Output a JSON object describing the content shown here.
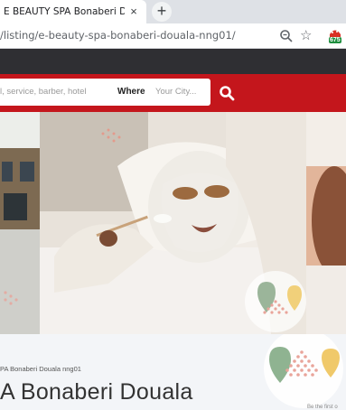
{
  "browser": {
    "tab_title": "E BEAUTY SPA Bonaberi Douala",
    "tab_close": "×",
    "new_tab": "+",
    "url": "/listing/e-beauty-spa-bonaberi-douala-nng01/",
    "icons": [
      "zoom-icon",
      "star-icon",
      "extension-icon"
    ],
    "extension_badge": "675"
  },
  "search": {
    "query_placeholder": "l, service, barber, hotel",
    "where_label": "Where",
    "city_placeholder": "Your City..."
  },
  "listing": {
    "breadcrumb": "PA Bonaberi Douala nng01",
    "title": "A Bonaberi Douala",
    "promo_text": "Be the first o"
  },
  "colors": {
    "header_red": "#c4161c",
    "site_strip": "#2f2f33",
    "info_bg": "#f3f5f8"
  }
}
